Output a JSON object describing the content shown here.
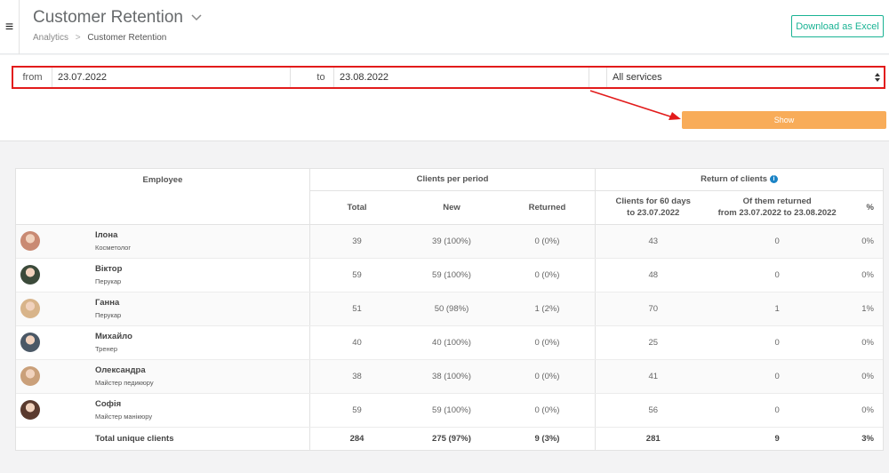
{
  "header": {
    "title": "Customer Retention",
    "breadcrumb": {
      "parent": "Analytics",
      "separator": ">",
      "current": "Customer Retention"
    },
    "download_label": "Download as Excel"
  },
  "filters": {
    "from_label": "from",
    "from_value": "23.07.2022",
    "to_label": "to",
    "to_value": "23.08.2022",
    "service_value": "All services",
    "show_label": "Show"
  },
  "table": {
    "group_headers": {
      "employee": "Employee",
      "clients_per_period": "Clients per period",
      "return_of_clients": "Return of clients"
    },
    "sub_headers": {
      "total": "Total",
      "new": "New",
      "returned": "Returned",
      "clients_60_days_line1": "Clients for 60 days",
      "clients_60_days_line2": "to 23.07.2022",
      "of_them_returned_line1": "Of them returned",
      "of_them_returned_line2": "from 23.07.2022 to 23.08.2022",
      "percent": "%"
    },
    "rows": [
      {
        "name": "Ілона",
        "role": "Косметолог",
        "total": "39",
        "new": "39 (100%)",
        "returned": "0 (0%)",
        "clients60": "43",
        "of_them": "0",
        "pct": "0%",
        "avatar_color": "#c98a73"
      },
      {
        "name": "Віктор",
        "role": "Перукар",
        "total": "59",
        "new": "59 (100%)",
        "returned": "0 (0%)",
        "clients60": "48",
        "of_them": "0",
        "pct": "0%",
        "avatar_color": "#3b4a3a"
      },
      {
        "name": "Ганна",
        "role": "Перукар",
        "total": "51",
        "new": "50 (98%)",
        "returned": "1 (2%)",
        "clients60": "70",
        "of_them": "1",
        "pct": "1%",
        "avatar_color": "#d8b48a"
      },
      {
        "name": "Михайло",
        "role": "Тренер",
        "total": "40",
        "new": "40 (100%)",
        "returned": "0 (0%)",
        "clients60": "25",
        "of_them": "0",
        "pct": "0%",
        "avatar_color": "#4a5866"
      },
      {
        "name": "Олександра",
        "role": "Майстер педикюру",
        "total": "38",
        "new": "38 (100%)",
        "returned": "0 (0%)",
        "clients60": "41",
        "of_them": "0",
        "pct": "0%",
        "avatar_color": "#caa07a"
      },
      {
        "name": "Софія",
        "role": "Майстер манікюру",
        "total": "59",
        "new": "59 (100%)",
        "returned": "0 (0%)",
        "clients60": "56",
        "of_them": "0",
        "pct": "0%",
        "avatar_color": "#5a3a2e"
      }
    ],
    "totals": {
      "label": "Total unique clients",
      "total": "284",
      "new": "275 (97%)",
      "returned": "9 (3%)",
      "clients60": "281",
      "of_them": "9",
      "pct": "3%"
    }
  },
  "colors": {
    "accent_green": "#1ab394",
    "show_orange": "#f8ac59",
    "highlight_red": "#e21b1b",
    "info_blue": "#1c84c6"
  }
}
